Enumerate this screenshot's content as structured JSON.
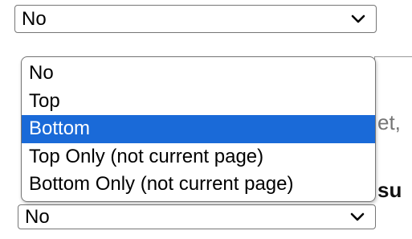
{
  "top_select": {
    "value": "No",
    "icon": "chevron-down-icon"
  },
  "background": {
    "partial_text": "et,",
    "partial_bold_text": "su"
  },
  "dropdown": {
    "options": [
      {
        "label": "No",
        "selected": false
      },
      {
        "label": "Top",
        "selected": false
      },
      {
        "label": "Bottom",
        "selected": true
      },
      {
        "label": "Top Only (not current page)",
        "selected": false
      },
      {
        "label": "Bottom Only (not current page)",
        "selected": false
      }
    ]
  },
  "bottom_select": {
    "value": "No",
    "icon": "chevron-down-icon"
  },
  "colors": {
    "highlight": "#1a6ad8",
    "border": "#767676",
    "muted_text": "#757575"
  }
}
